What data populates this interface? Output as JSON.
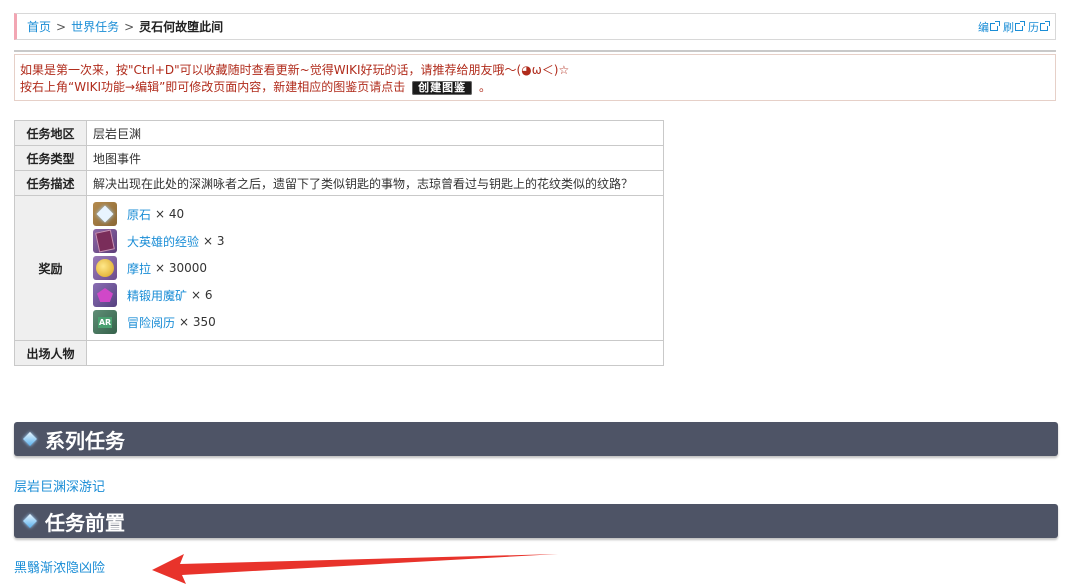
{
  "breadcrumb": {
    "home": "首页",
    "sep1": ">",
    "parent": "世界任务",
    "sep2": ">",
    "current": "灵石何故堕此间"
  },
  "tools": [
    {
      "label": "编",
      "icon": "external-link-icon"
    },
    {
      "label": "刷",
      "icon": "external-link-icon"
    },
    {
      "label": "历",
      "icon": "external-link-icon"
    }
  ],
  "notice": {
    "line1": "如果是第一次来，按\"Ctrl+D\"可以收藏随时查看更新~觉得WIKI好玩的话，请推荐给朋友哦～(◕ω＜)☆",
    "line2_prefix": "按右上角“WIKI功能→编辑”即可修改页面内容，新建相应的图鉴页请点击",
    "create_button": "创建图鉴",
    "line2_suffix": "。"
  },
  "info": {
    "region_key": "任务地区",
    "region_val": "层岩巨渊",
    "type_key": "任务类型",
    "type_val": "地图事件",
    "desc_key": "任务描述",
    "desc_val": "解决出现在此处的深渊咏者之后，遗留下了类似钥匙的事物，志琼曾看过与钥匙上的花纹类似的纹路？",
    "reward_key": "奖励",
    "rewards": [
      {
        "name": "原石",
        "qty": "× 40",
        "icon": "primogem-icon"
      },
      {
        "name": "大英雄的经验",
        "qty": "× 3",
        "icon": "heros-wit-icon"
      },
      {
        "name": "摩拉",
        "qty": "× 30000",
        "icon": "mora-icon"
      },
      {
        "name": "精锻用魔矿",
        "qty": "× 6",
        "icon": "mystic-ore-icon"
      },
      {
        "name": "冒险阅历",
        "qty": "× 350",
        "icon": "adventure-exp-icon"
      }
    ],
    "characters_key": "出场人物",
    "characters_val": ""
  },
  "sections": [
    {
      "title": "系列任务",
      "link": "层岩巨渊深游记"
    },
    {
      "title": "任务前置",
      "link": "黑翳渐浓隐凶险"
    }
  ],
  "colors": {
    "link": "#1a8dd6",
    "notice_text": "#b02b1b",
    "section_bg": "#4e5466",
    "arrow": "#e8332b"
  }
}
